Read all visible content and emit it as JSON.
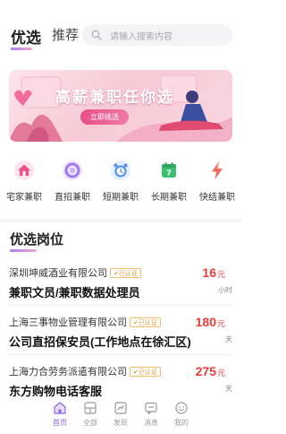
{
  "header": {
    "tabs": [
      {
        "label": "优选",
        "active": true
      },
      {
        "label": "推荐",
        "active": false
      }
    ],
    "search": {
      "placeholder": "请输入搜索内容",
      "icon": "search-icon"
    }
  },
  "banner": {
    "title": "高薪兼职任你选",
    "button_label": "立即挑选"
  },
  "categories": [
    {
      "label": "宅家兼职",
      "icon": "house-icon",
      "color": "#f0508a"
    },
    {
      "label": "直招兼职",
      "icon": "ring-icon",
      "color": "#a07af0"
    },
    {
      "label": "短期兼职",
      "icon": "alarm-clock-icon",
      "color": "#4d8ff0"
    },
    {
      "label": "长期兼职",
      "icon": "calendar-icon",
      "color": "#3cc070"
    },
    {
      "label": "快结兼职",
      "icon": "lightning-icon",
      "color": "#f06a5a"
    }
  ],
  "section": {
    "title": "优选岗位"
  },
  "jobs": [
    {
      "company": "深圳坤威酒业有限公司",
      "badge": "已认证",
      "title": "兼职文员/兼职数据处理员",
      "price": "16",
      "currency": "元",
      "unit": "小时"
    },
    {
      "company": "上海三事物业管理有限公司",
      "badge": "已认证",
      "title": "公司直招保安员(工作地点在徐汇区)",
      "price": "180",
      "currency": "元",
      "unit": "天"
    },
    {
      "company": "上海力合劳务派遣有限公司",
      "badge": "已认证",
      "title": "东方购物电话客服",
      "price": "275",
      "currency": "元",
      "unit": "天"
    }
  ],
  "bottom_nav": [
    {
      "label": "首页",
      "icon": "home-icon",
      "active": true
    },
    {
      "label": "全部",
      "icon": "grid-icon",
      "active": false
    },
    {
      "label": "发现",
      "icon": "discover-icon",
      "active": false
    },
    {
      "label": "消息",
      "icon": "message-icon",
      "active": false
    },
    {
      "label": "我的",
      "icon": "profile-icon",
      "active": false
    }
  ],
  "colors": {
    "accent": "#8e63e8",
    "price": "#ee3a3a",
    "badge": "#e0a030"
  }
}
